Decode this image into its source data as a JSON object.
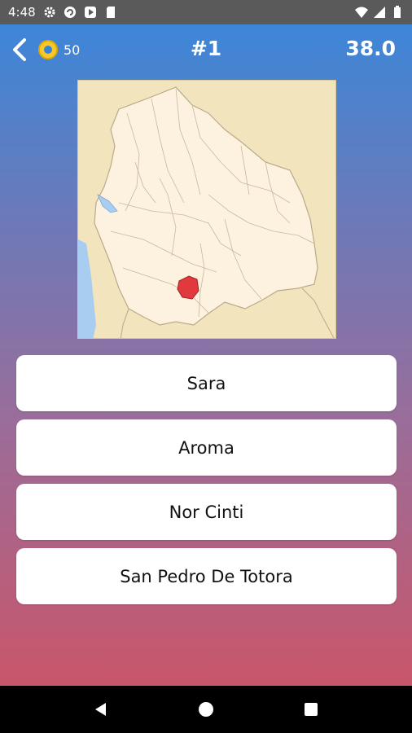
{
  "status_bar": {
    "time": "4:48",
    "left_icons": [
      "settings-icon",
      "sync-icon",
      "play-store-icon",
      "sd-card-icon"
    ],
    "right_icons": [
      "wifi-icon",
      "signal-icon",
      "battery-icon"
    ]
  },
  "header": {
    "coins": "50",
    "question_number": "#1",
    "timer": "38.0"
  },
  "map": {
    "highlight_color": "#e03a3e",
    "land_color": "#fdf2e0",
    "water_color": "#a9cdf0",
    "background_color": "#f2e4bd"
  },
  "answers": [
    {
      "label": "Sara"
    },
    {
      "label": "Aroma"
    },
    {
      "label": "Nor Cinti"
    },
    {
      "label": "San Pedro De Totora"
    }
  ],
  "nav": {
    "buttons": [
      "back-icon",
      "home-icon",
      "recents-icon"
    ]
  }
}
